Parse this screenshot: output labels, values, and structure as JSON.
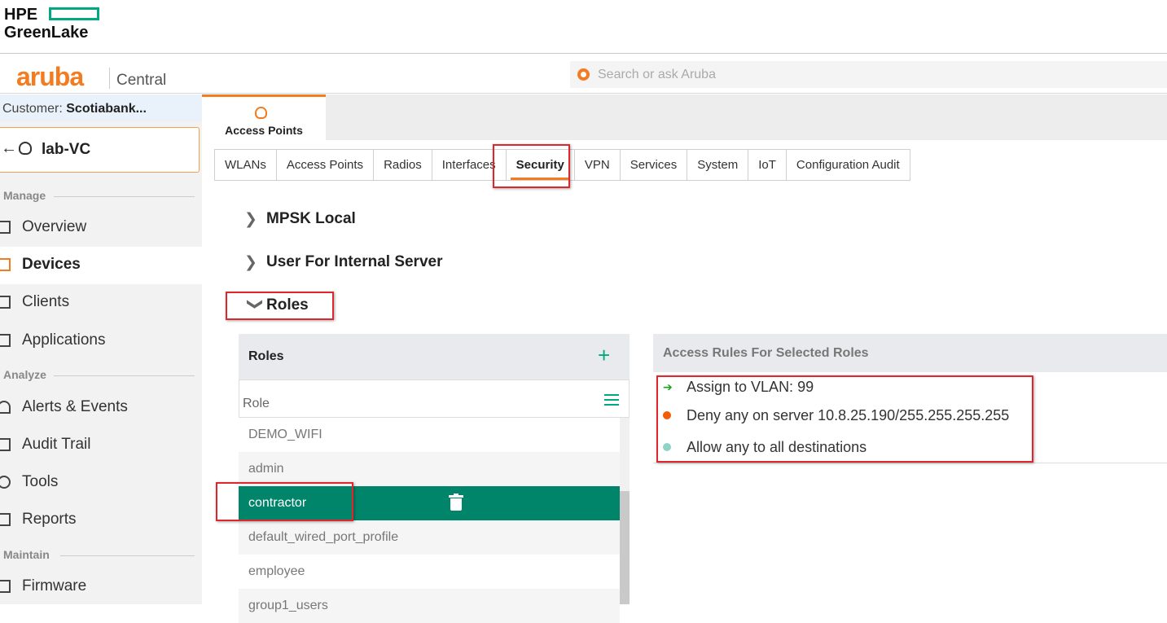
{
  "hpe": {
    "line1": "HPE",
    "line2": "GreenLake"
  },
  "aruba": {
    "logo": "aruba",
    "product": "Central"
  },
  "search": {
    "placeholder": "Search or ask Aruba"
  },
  "sidebar": {
    "customer_label": "Customer: ",
    "customer_name": "Scotiabank...",
    "context_name": "lab-VC",
    "sections": {
      "manage": "Manage",
      "analyze": "Analyze",
      "maintain": "Maintain"
    },
    "items": [
      {
        "label": "Overview",
        "icon": "grid-icon"
      },
      {
        "label": "Devices",
        "icon": "devices-icon",
        "active": true
      },
      {
        "label": "Clients",
        "icon": "clients-icon"
      },
      {
        "label": "Applications",
        "icon": "applications-icon"
      },
      {
        "label": "Alerts & Events",
        "icon": "bell-icon"
      },
      {
        "label": "Audit Trail",
        "icon": "audit-icon"
      },
      {
        "label": "Tools",
        "icon": "wrench-icon"
      },
      {
        "label": "Reports",
        "icon": "reports-icon"
      },
      {
        "label": "Firmware",
        "icon": "chip-icon"
      }
    ]
  },
  "device_tab": {
    "label": "Access Points"
  },
  "tabs": [
    "WLANs",
    "Access Points",
    "Radios",
    "Interfaces",
    "Security",
    "VPN",
    "Services",
    "System",
    "IoT",
    "Configuration Audit"
  ],
  "active_tab": "Security",
  "accordions": {
    "mpsk": "MPSK Local",
    "internal_server": "User For Internal Server",
    "roles": "Roles"
  },
  "roles_panel": {
    "title": "Roles",
    "column": "Role",
    "rows": [
      "DEMO_WIFI",
      "admin",
      "contractor",
      "default_wired_port_profile",
      "employee",
      "group1_users"
    ],
    "selected": "contractor"
  },
  "rules_panel": {
    "title": "Access Rules For Selected Roles",
    "rules": [
      {
        "text": "Assign to VLAN: 99",
        "color": "#1aa31a"
      },
      {
        "text": "Deny any on server 10.8.25.190/255.255.255.255",
        "color": "#f25c05"
      },
      {
        "text": "Allow any to all destinations",
        "color": "#8fd3c6"
      }
    ]
  },
  "colors": {
    "accent": "#f47b20",
    "selected_row": "#00846a",
    "highlight": "#e0262d"
  }
}
